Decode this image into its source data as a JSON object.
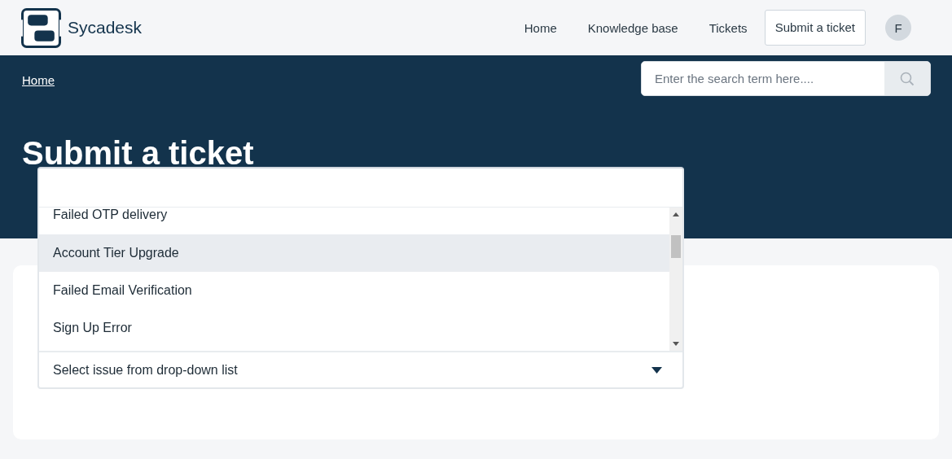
{
  "brand": {
    "name": "Sycadesk"
  },
  "nav": [
    {
      "label": "Home",
      "kind": "link"
    },
    {
      "label": "Knowledge base",
      "kind": "link"
    },
    {
      "label": "Tickets",
      "kind": "link"
    },
    {
      "label": "Submit a ticket",
      "kind": "button"
    }
  ],
  "avatar": {
    "initial": "F"
  },
  "breadcrumb": "Home",
  "search": {
    "placeholder": "Enter the search term here...."
  },
  "heading": "Submit a ticket",
  "dropdown": {
    "options": [
      {
        "label": "Failed OTP delivery",
        "selected": false
      },
      {
        "label": "Account Tier Upgrade",
        "selected": true
      },
      {
        "label": "Failed Email Verification",
        "selected": false
      },
      {
        "label": "Sign Up Error",
        "selected": false
      }
    ],
    "placeholder": "Select issue from drop-down list"
  }
}
